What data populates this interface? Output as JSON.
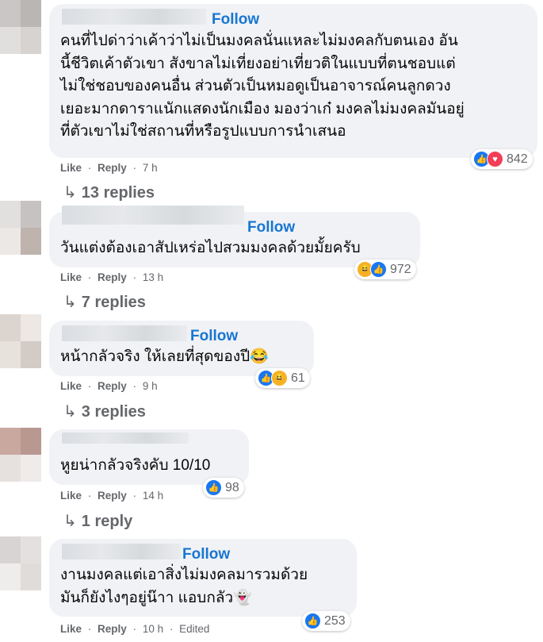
{
  "comments": [
    {
      "follow": "Follow",
      "text": "คนที่ไปด่าว่าเค้าว่าไม่เป็นมงคลนั่นแหละไม่มงคลกับตนเอง อัน\nนี้ชีวิตเค้าตัวเขา สังขาลไม่เที่ยงอย่าเที่ยวติในแบบที่ตนชอบแต่\nไม่ใช่ชอบของคนอื่น ส่วนตัวเป็นหมอดูเป็นอาจารณ์คนลูกดวง\nเยอะมากดาราแนักแสดงนักเมือง มองว่าเก๋ มงคลไม่มงคลมันอยู่\nที่ตัวเขาไม่ใช่สถานที่หรือรูปแบบการนำเสนอ",
      "like": "Like",
      "reply": "Reply",
      "time": "7 h",
      "edited": "",
      "reactions": [
        "like-icon",
        "love-icon"
      ],
      "count": "842",
      "replies": "13 replies"
    },
    {
      "follow": "Follow",
      "text": "วันแต่งต้องเอาสัปเหร่อไปสวมมงคลด้วยมั้ยครับ",
      "like": "Like",
      "reply": "Reply",
      "time": "13 h",
      "edited": "",
      "reactions": [
        "haha-icon",
        "like-icon"
      ],
      "count": "972",
      "replies": "7 replies"
    },
    {
      "follow": "Follow",
      "text": "หน้ากลัวจริง ให้เลยที่สุดของปี😂",
      "like": "Like",
      "reply": "Reply",
      "time": "9 h",
      "edited": "",
      "reactions": [
        "like-icon",
        "haha-icon"
      ],
      "count": "61",
      "replies": "3 replies"
    },
    {
      "follow": "",
      "text": "หูยน่ากลัวจริงคับ 10/10",
      "like": "Like",
      "reply": "Reply",
      "time": "14 h",
      "edited": "",
      "reactions": [
        "like-icon"
      ],
      "count": "98",
      "replies": "1 reply"
    },
    {
      "follow": "Follow",
      "text": "งานมงคลแต่เอาสิ่งไม่มงคลมารวมด้วย\nมันก็ยังไงๆอยู่น๊าา แอบกลัว👻",
      "like": "Like",
      "reply": "Reply",
      "time": "10 h",
      "edited": "Edited",
      "reactions": [
        "like-icon"
      ],
      "count": "253",
      "replies": ""
    }
  ],
  "separator": "·",
  "colors": {
    "follow": "#1876d2",
    "bubble": "#f0f2f5",
    "meta": "#65676b",
    "like": "#1877f2",
    "love": "#f33e58",
    "haha": "#f7b125"
  }
}
